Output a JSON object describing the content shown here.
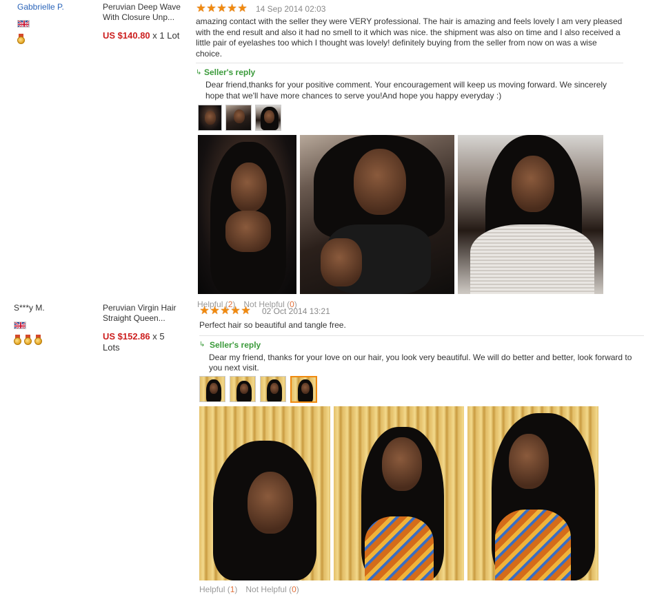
{
  "reviews": [
    {
      "user": "Gabbrielle P.",
      "user_is_link": true,
      "flag": "uk-flag-icon",
      "medals": 1,
      "product": "Peruvian Deep Wave With Closure Unp...",
      "price": "US $140.80",
      "qty": "x 1 Lot",
      "stars": 5,
      "star_symbol": "★",
      "date": "14 Sep 2014 02:03",
      "text": "amazing contact with the seller they were VERY professional. The hair is amazing and feels lovely I am very pleased with the end result and also it had no smell to it which was nice. the shipment was also on time and I also received a little pair of eyelashes too which I thought was lovely! definitely buying from the seller from now on was a wise choice.",
      "reply_title": "Seller's reply",
      "reply_icon": "↳",
      "reply_text": "Dear friend,thanks for your positive comment. Your encouragement will keep us moving forward. We sincerely hope that we'll have more chances to serve you!And hope you happy everyday :)",
      "helpful_label": "Helpful",
      "helpful_count": "2",
      "not_helpful_label": "Not Helpful",
      "not_helpful_count": "0"
    },
    {
      "user": "S***y M.",
      "user_is_link": false,
      "flag": "uk-flag-icon",
      "medals": 3,
      "product": "Peruvian Virgin Hair Straight Queen...",
      "price": "US $152.86",
      "qty": "x 5 Lots",
      "stars": 5,
      "star_symbol": "★",
      "date": "02 Oct 2014 13:21",
      "text": "Perfect hair so beautiful and tangle free.",
      "reply_title": "Seller's reply",
      "reply_icon": "↳",
      "reply_text": "Dear my friend, thanks for your love on our hair, you look very beautiful. We will do better and better, look forward to you next visit.",
      "helpful_label": "Helpful",
      "helpful_count": "1",
      "not_helpful_label": "Not Helpful",
      "not_helpful_count": "0"
    }
  ],
  "colors": {
    "link": "#2a64b9",
    "price": "#cc1f1f",
    "star": "#f08a10",
    "reply": "#3a9a3a",
    "count": "#e0703a"
  }
}
